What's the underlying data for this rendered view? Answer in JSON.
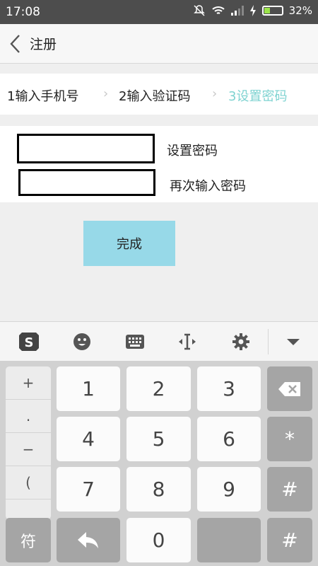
{
  "status_bar": {
    "time": "17:08",
    "battery": "32%"
  },
  "header": {
    "title": "注册"
  },
  "steps": [
    {
      "label": "1输入手机号"
    },
    {
      "label": "2输入验证码"
    },
    {
      "label": "3设置密码"
    }
  ],
  "form": {
    "password_label": "设置密码",
    "confirm_label": "再次输入密码",
    "password_value": "",
    "confirm_value": ""
  },
  "submit_label": "完成",
  "keyboard": {
    "symbols": [
      "+",
      ".",
      "−",
      "(",
      "、"
    ],
    "digits": [
      "1",
      "2",
      "3",
      "4",
      "5",
      "6",
      "7",
      "8",
      "9",
      "0"
    ],
    "side_keys": [
      "*",
      "#",
      "#"
    ],
    "symbol_key": "符",
    "toolbar_icons": [
      "sogou-logo-icon",
      "emoji-icon",
      "keyboard-icon",
      "cursor-icon",
      "settings-icon",
      "collapse-icon"
    ]
  }
}
